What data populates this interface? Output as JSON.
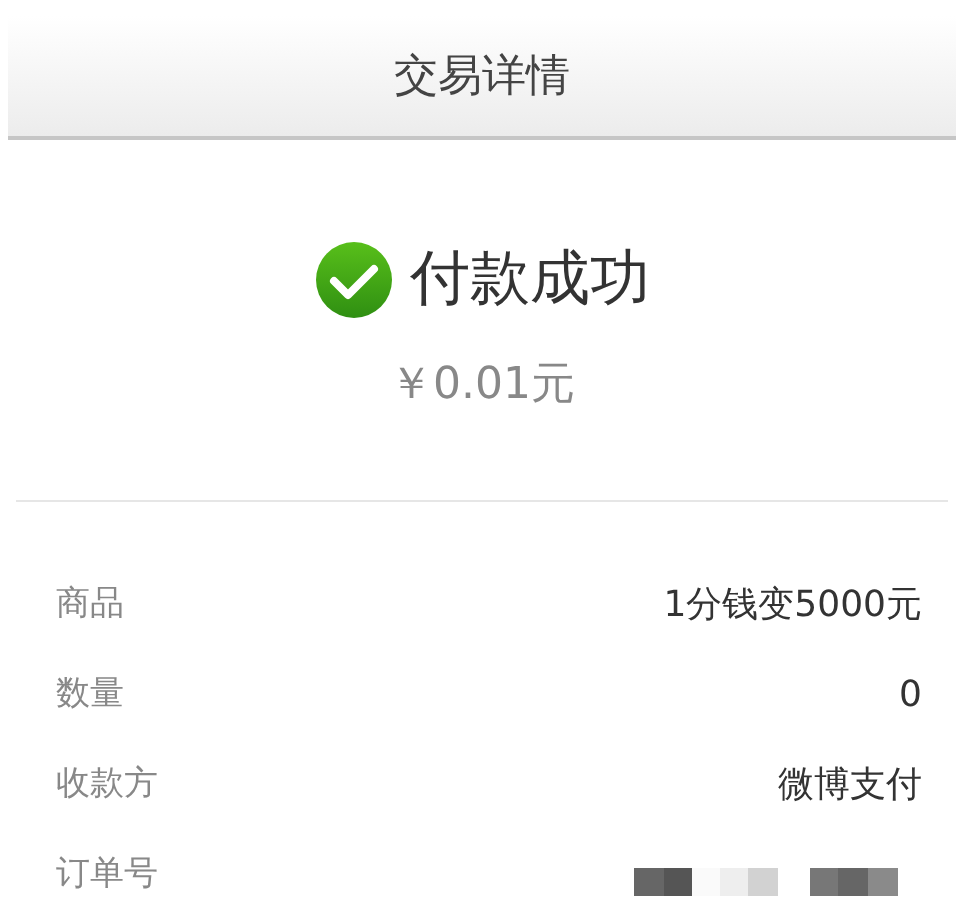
{
  "header": {
    "title": "交易详情"
  },
  "result": {
    "kind": "success",
    "title": "付款成功",
    "amount": "￥0.01元"
  },
  "details": [
    {
      "kind": "text",
      "label": "商品",
      "value": "1分钱变5000元"
    },
    {
      "kind": "text",
      "label": "数量",
      "value": "0"
    },
    {
      "kind": "text",
      "label": "收款方",
      "value": "微博支付"
    },
    {
      "kind": "masked",
      "label": "订单号"
    }
  ]
}
